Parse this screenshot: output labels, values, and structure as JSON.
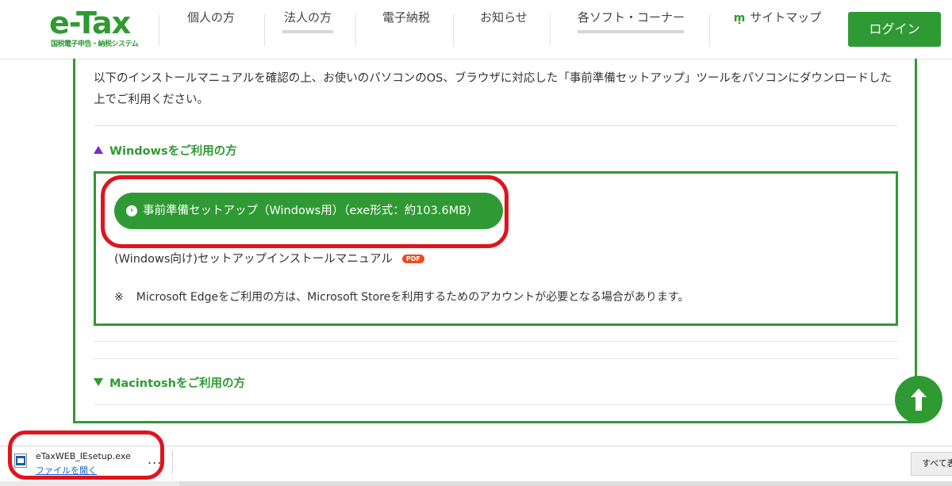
{
  "header": {
    "logo_text": "e-Tax",
    "logo_sub": "国税電子申告・納税システム",
    "nav": [
      {
        "label": "個人の方"
      },
      {
        "label": "法人の方"
      },
      {
        "label": "電子納税"
      },
      {
        "label": "お知らせ"
      },
      {
        "label": "各ソフト・コーナー"
      },
      {
        "label": "サイトマップ"
      }
    ],
    "login_label": "ログイン"
  },
  "content": {
    "intro": "以下のインストールマニュアルを確認の上、お使いのパソコンのOS、ブラウザに対応した「事前準備セットアップ」ツールをパソコンにダウンロードした上でご利用ください。",
    "windows_title": "Windowsをご利用の方",
    "download_button": "事前準備セットアップ（Windows用）（exe形式：約103.6MB)",
    "manual_link": "(Windows向け)セットアップインストールマニュアル",
    "pdf_badge": "PDF",
    "note_mark": "※",
    "note": "Microsoft Edgeをご利用の方は、Microsoft Storeを利用するためのアカウントが必要となる場合があります。",
    "mac_title": "Macintoshをご利用の方"
  },
  "download_bar": {
    "file_name": "eTaxWEB_IEsetup.exe",
    "open_label": "ファイルを開く",
    "more": "...",
    "show_all": "すべて表示"
  },
  "colors": {
    "brand_green": "#2f9a33",
    "annotation_red": "#e0141e",
    "windows_triangle": "#7a2bcc",
    "pdf_badge": "#ee4a1a"
  }
}
